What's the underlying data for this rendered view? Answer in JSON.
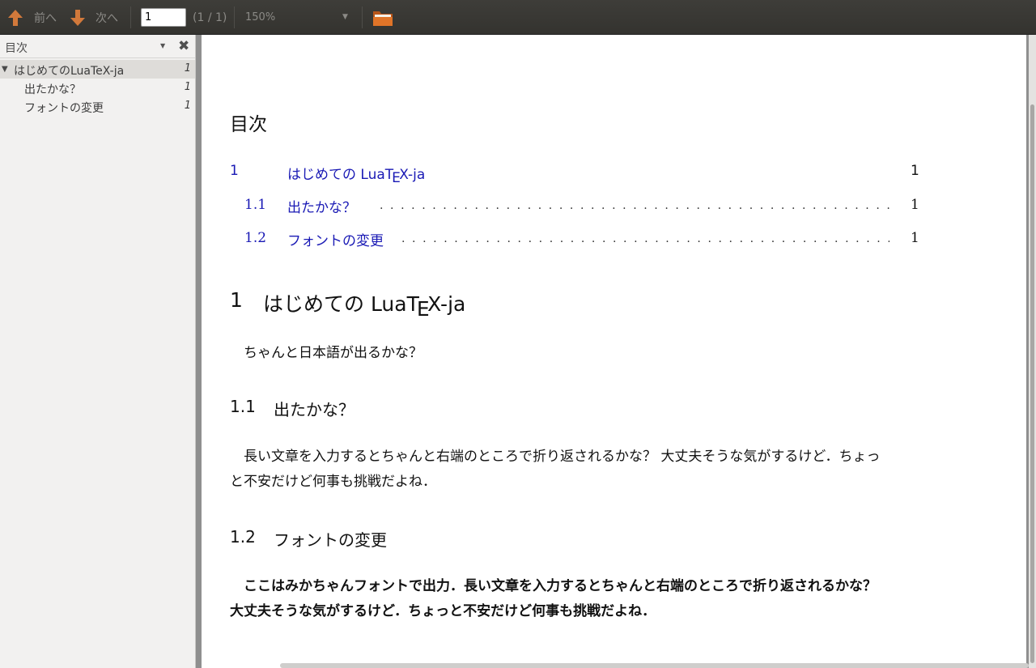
{
  "toolbar": {
    "prev_label": "前へ",
    "next_label": "次へ",
    "page_value": "1",
    "page_count": "(1 / 1)",
    "zoom_value": "150%",
    "icons": [
      "arrow-up-icon",
      "arrow-down-icon",
      "chevron-down-icon",
      "folder-icon"
    ],
    "arrow_color": "#d2793b",
    "folder_color": "#e07428"
  },
  "sidebar": {
    "title": "目次",
    "items": [
      {
        "label": "はじめてのLuaTeX-ja",
        "page": "1"
      },
      {
        "label": "出たかな？",
        "page": "1"
      },
      {
        "label": "フォントの変更",
        "page": "1"
      }
    ]
  },
  "document": {
    "toc_heading": "目次",
    "toc": [
      {
        "num": "1",
        "label_prefix": "はじめての LuaT",
        "label_e": "E",
        "label_suffix": "X-ja",
        "page": "1"
      },
      {
        "num": "1.1",
        "label": "出たかな？",
        "page": "1"
      },
      {
        "num": "1.2",
        "label": "フォントの変更",
        "page": "1"
      }
    ],
    "link_color": "#1a1ab5",
    "section1": {
      "num": "1",
      "title_prefix": "はじめての LuaT",
      "title_e": "E",
      "title_suffix": "X-ja",
      "body": "ちゃんと日本語が出るかな？"
    },
    "section11": {
      "num": "1.1",
      "title": "出たかな？",
      "body_line1": "長い文章を入力するとちゃんと右端のところで折り返されるかな？ 大丈夫そうな気がするけど．ちょっ",
      "body_line2": "と不安だけど何事も挑戦だよね．"
    },
    "section12": {
      "num": "1.2",
      "title": "フォントの変更",
      "body_line1": "ここはみかちゃんフォントで出力．長い文章を入力するとちゃんと右端のところで折り返されるかな？",
      "body_line2": "大丈夫そうな気がするけど．ちょっと不安だけど何事も挑戦だよね．"
    }
  }
}
